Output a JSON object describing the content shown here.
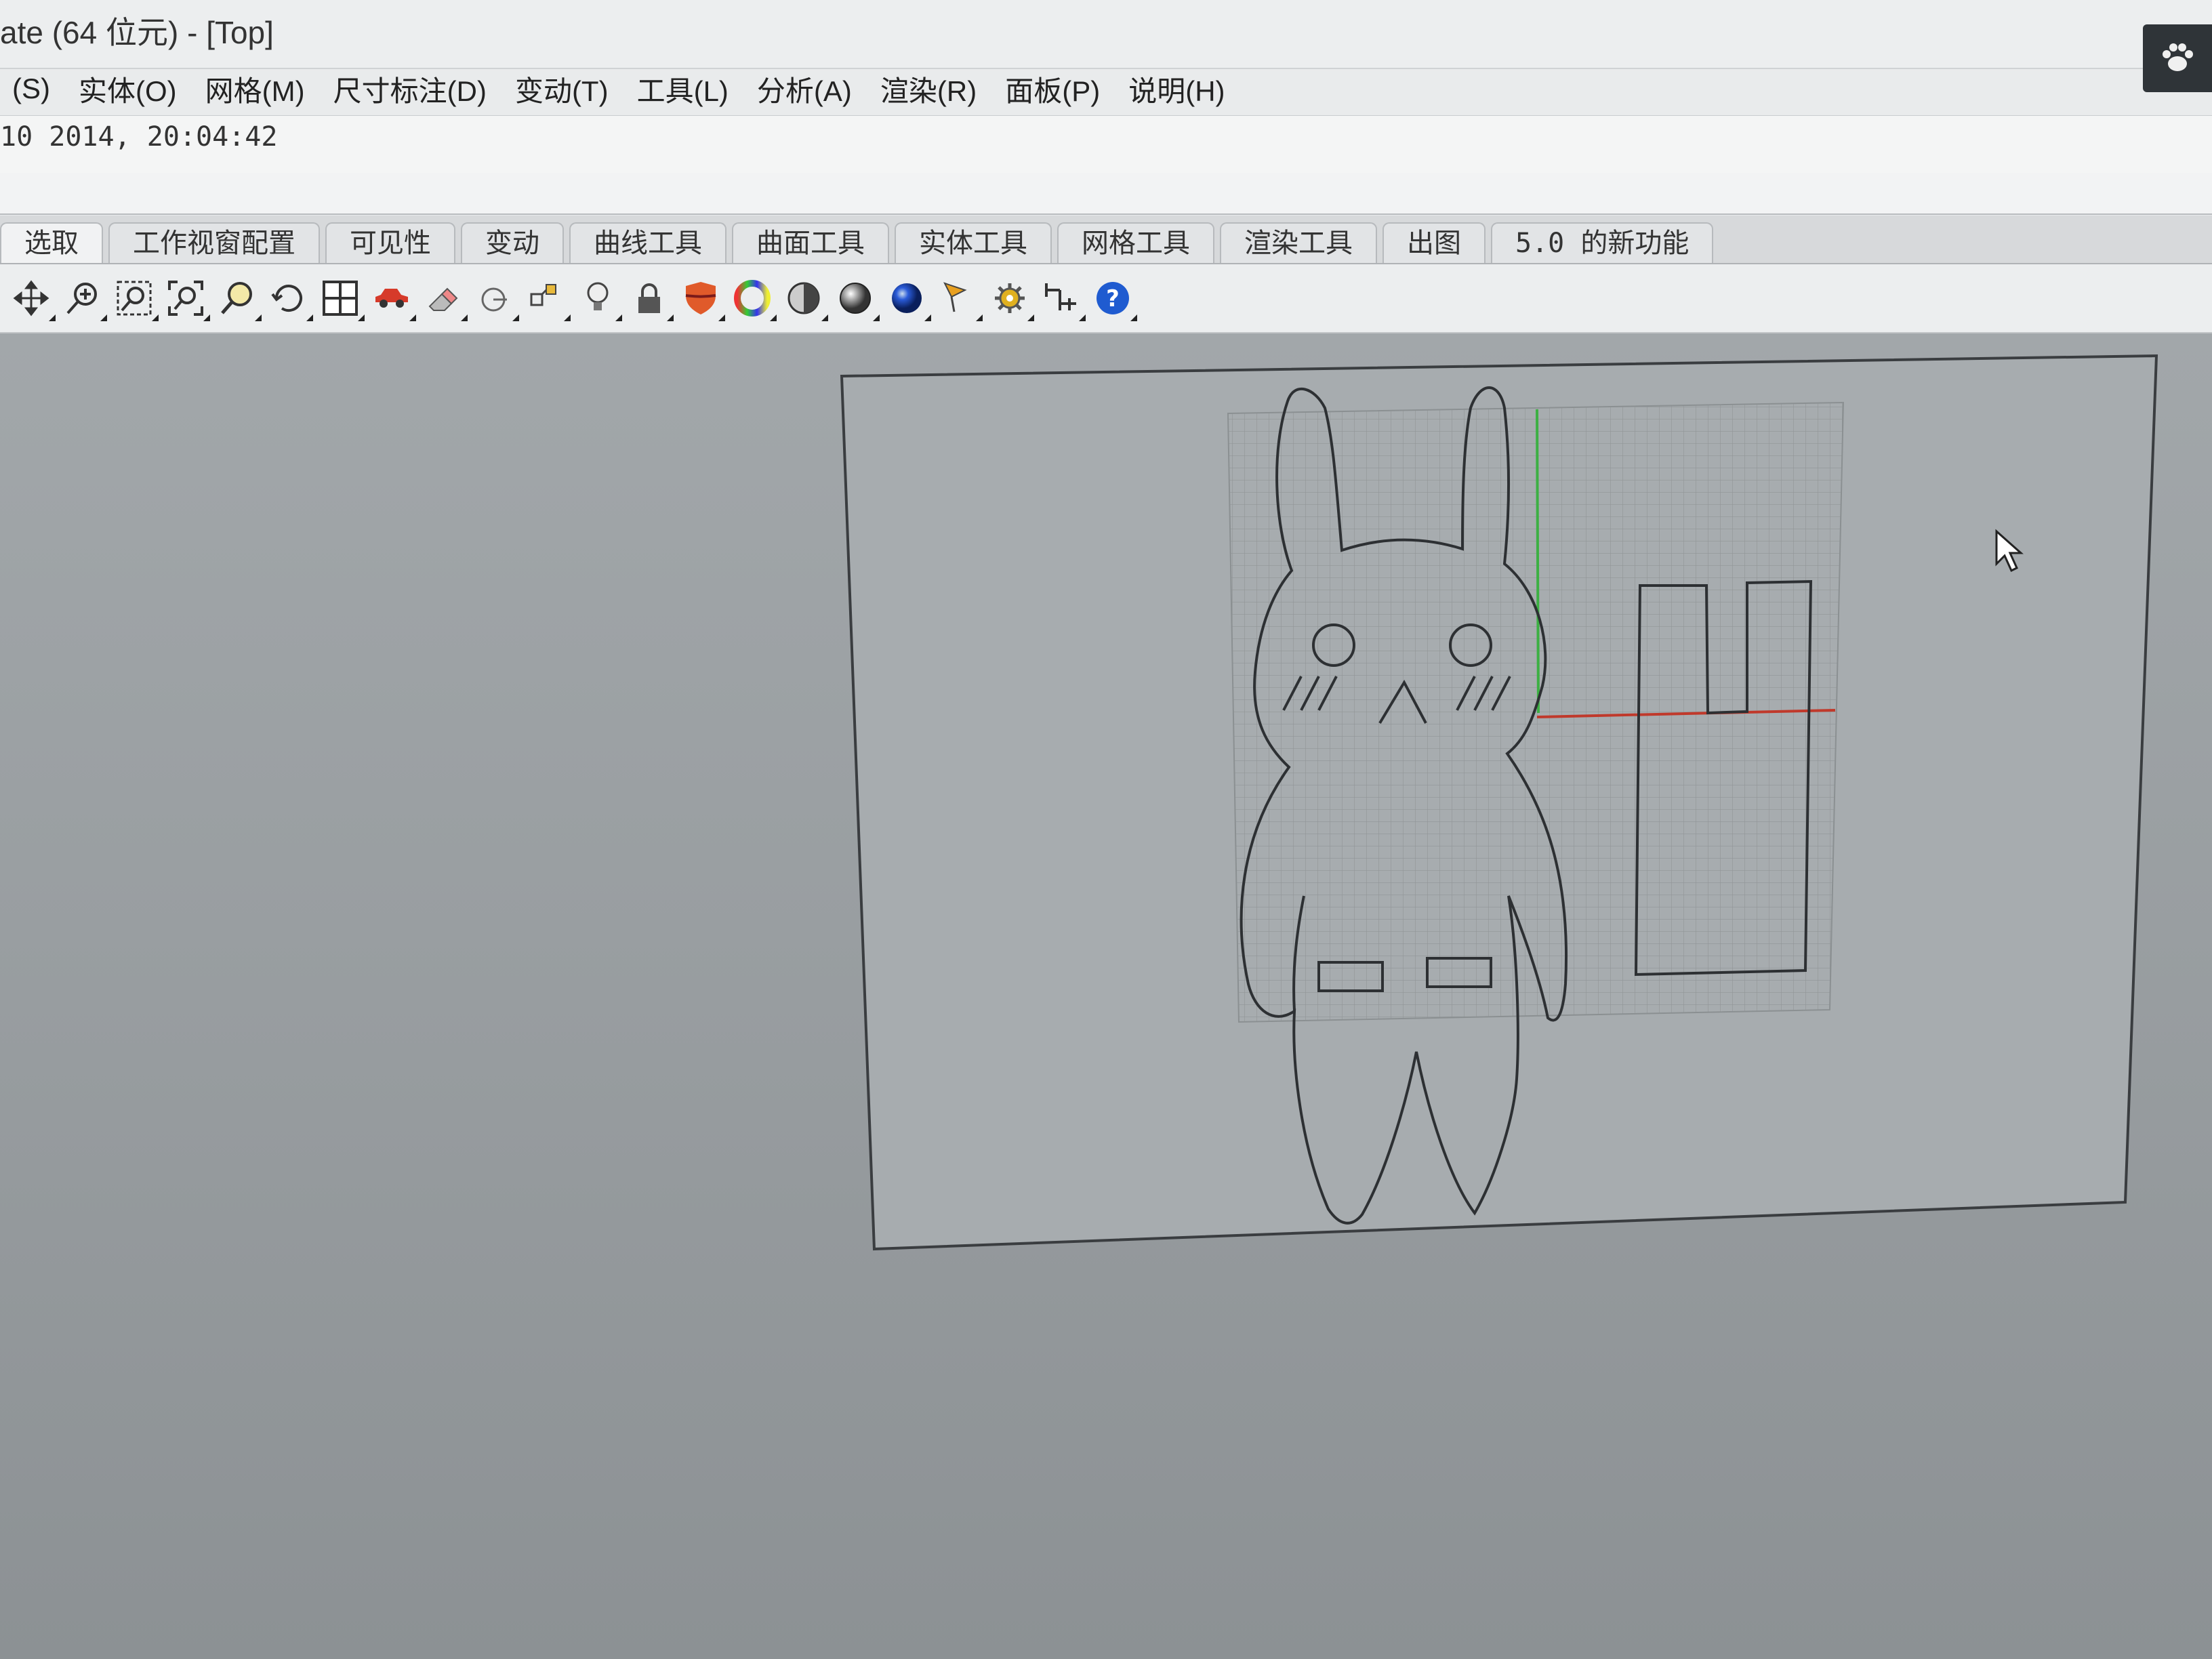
{
  "window": {
    "title": "ate (64 位元) - [Top]"
  },
  "menu": {
    "items": [
      {
        "label": "(S)"
      },
      {
        "label": "实体(O)"
      },
      {
        "label": "网格(M)"
      },
      {
        "label": "尺寸标注(D)"
      },
      {
        "label": "变动(T)"
      },
      {
        "label": "工具(L)"
      },
      {
        "label": "分析(A)"
      },
      {
        "label": "渲染(R)"
      },
      {
        "label": "面板(P)"
      },
      {
        "label": "说明(H)"
      }
    ]
  },
  "command": {
    "history": "10 2014, 20:04:42",
    "prompt": ""
  },
  "tabs": [
    {
      "label": "选取"
    },
    {
      "label": "工作视窗配置"
    },
    {
      "label": "可见性"
    },
    {
      "label": "变动"
    },
    {
      "label": "曲线工具"
    },
    {
      "label": "曲面工具"
    },
    {
      "label": "实体工具"
    },
    {
      "label": "网格工具"
    },
    {
      "label": "渲染工具"
    },
    {
      "label": "出图"
    },
    {
      "label": "5.0 的新功能"
    }
  ],
  "toolbar": {
    "tools": [
      "pan-icon",
      "zoom-in-icon",
      "zoom-window-icon",
      "zoom-extents-icon",
      "zoom-selected-icon",
      "rotate-view-icon",
      "viewport-layout-icon",
      "car-icon",
      "eraser-icon",
      "hide-icon",
      "show-objects-icon",
      "light-bulb-icon",
      "lock-icon",
      "shield-icon",
      "color-wheel-icon",
      "half-shaded-sphere-icon",
      "shaded-sphere-icon",
      "blue-sphere-icon",
      "pencil-flag-icon",
      "gear-icon",
      "dimension-icon",
      "help-icon"
    ]
  },
  "viewport": {
    "name": "Top",
    "axis_colors": {
      "x": "#c0392b",
      "y": "#27ae60"
    }
  }
}
